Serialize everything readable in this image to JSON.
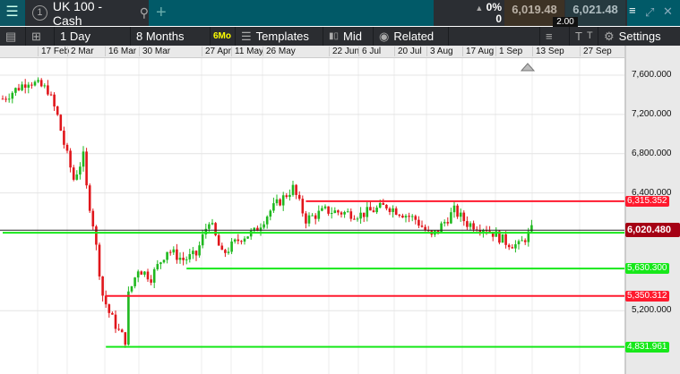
{
  "tab": {
    "number": "1",
    "title": "UK 100 - Cash"
  },
  "quote": {
    "change_pct": "0%",
    "change_abs": "0",
    "bid": "6,019.48",
    "ask": "6,021.48",
    "spread": "2.00"
  },
  "toolbar": {
    "interval": "1 Day",
    "range": "8 Months",
    "range_badge": "6Mo",
    "templates": "Templates",
    "price_type": "Mid",
    "related": "Related",
    "settings": "Settings"
  },
  "chart_data": {
    "type": "candlestick",
    "x_ticks": [
      "17 Feb",
      "2 Mar",
      "16 Mar",
      "30 Mar",
      "27 Apr",
      "11 May",
      "26 May",
      "22 Jun",
      "6 Jul",
      "20 Jul",
      "3 Aug",
      "17 Aug",
      "1 Sep",
      "13 Sep",
      "27 Sep"
    ],
    "y_ticks": [
      "7,600.000",
      "7,200.000",
      "6,800.000",
      "6,400.000",
      "5,200.000"
    ],
    "y_tick_values": [
      7600,
      7200,
      6800,
      6400,
      5200
    ],
    "ylim": [
      4700,
      7900
    ],
    "close_path_approx": [
      [
        0,
        7360
      ],
      [
        8,
        7545
      ],
      [
        14,
        7450
      ],
      [
        17,
        7180
      ],
      [
        19,
        6900
      ],
      [
        22,
        6540
      ],
      [
        25,
        6770
      ],
      [
        26,
        6450
      ],
      [
        28,
        6090
      ],
      [
        31,
        5360
      ],
      [
        33,
        5180
      ],
      [
        36,
        4990
      ],
      [
        38,
        4900
      ],
      [
        39,
        5360
      ],
      [
        42,
        5630
      ],
      [
        46,
        5540
      ],
      [
        51,
        5820
      ],
      [
        56,
        5720
      ],
      [
        60,
        5770
      ],
      [
        64,
        6130
      ],
      [
        68,
        5770
      ],
      [
        74,
        5950
      ],
      [
        78,
        6000
      ],
      [
        83,
        6220
      ],
      [
        90,
        6450
      ],
      [
        94,
        6130
      ],
      [
        100,
        6220
      ],
      [
        111,
        6180
      ],
      [
        119,
        6270
      ],
      [
        128,
        6130
      ],
      [
        133,
        5950
      ],
      [
        140,
        6220
      ],
      [
        144,
        6090
      ],
      [
        150,
        6040
      ],
      [
        156,
        5900
      ],
      [
        160,
        5860
      ],
      [
        164,
        6020
      ]
    ],
    "current_price": "6,020.480",
    "levels": [
      {
        "value": 6315.352,
        "label": "6,315.352",
        "color": "#ff1a2e",
        "start_day": 94
      },
      {
        "value": 5995,
        "label": "",
        "color": "#17e81a",
        "start_day": 0
      },
      {
        "value": 5630.3,
        "label": "5,630.300",
        "color": "#17e81a",
        "start_day": 57
      },
      {
        "value": 5350.312,
        "label": "5,350.312",
        "color": "#ff1a2e",
        "start_day": 32
      },
      {
        "value": 4831.961,
        "label": "4,831.961",
        "color": "#17e81a",
        "start_day": 32
      }
    ],
    "current_value": 6020.48
  }
}
